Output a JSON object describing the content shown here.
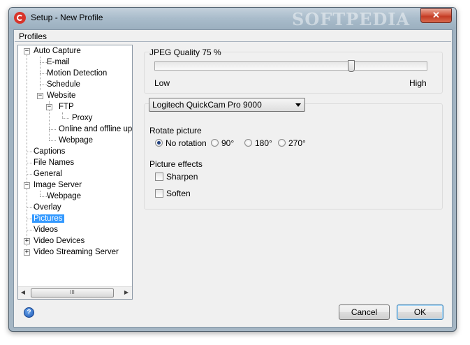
{
  "window": {
    "title": "Setup - New Profile",
    "watermark": "SOFTPEDIA",
    "close_glyph": "✕"
  },
  "group_label": "Profiles",
  "tree": {
    "items": [
      {
        "label": "Auto Capture",
        "expander": "−"
      },
      {
        "label": "E-mail"
      },
      {
        "label": "Motion Detection"
      },
      {
        "label": "Schedule"
      },
      {
        "label": "Website",
        "expander": "−"
      },
      {
        "label": "FTP",
        "expander": "−"
      },
      {
        "label": "Proxy"
      },
      {
        "label": "Online and offline uplo"
      },
      {
        "label": "Webpage"
      },
      {
        "label": "Captions"
      },
      {
        "label": "File Names"
      },
      {
        "label": "General"
      },
      {
        "label": "Image Server",
        "expander": "−"
      },
      {
        "label": "Webpage"
      },
      {
        "label": "Overlay"
      },
      {
        "label": "Pictures",
        "selected": true
      },
      {
        "label": "Videos"
      },
      {
        "label": "Video Devices",
        "expander": "+"
      },
      {
        "label": "Video Streaming Server",
        "expander": "+"
      }
    ],
    "scroll_left": "◀",
    "scroll_right": "▶",
    "scroll_grip": "III"
  },
  "quality": {
    "label": "JPEG Quality 75 %",
    "value_percent": 75,
    "low": "Low",
    "high": "High"
  },
  "camera": {
    "selected": "Logitech QuickCam Pro 9000"
  },
  "rotate": {
    "label": "Rotate picture",
    "options": [
      {
        "label": "No rotation",
        "checked": true
      },
      {
        "label": "90°"
      },
      {
        "label": "180°"
      },
      {
        "label": "270°"
      }
    ]
  },
  "effects": {
    "label": "Picture effects",
    "options": [
      {
        "label": "Sharpen",
        "checked": false
      },
      {
        "label": "Soften",
        "checked": false
      }
    ]
  },
  "footer": {
    "help_glyph": "?",
    "cancel": "Cancel",
    "ok": "OK"
  }
}
